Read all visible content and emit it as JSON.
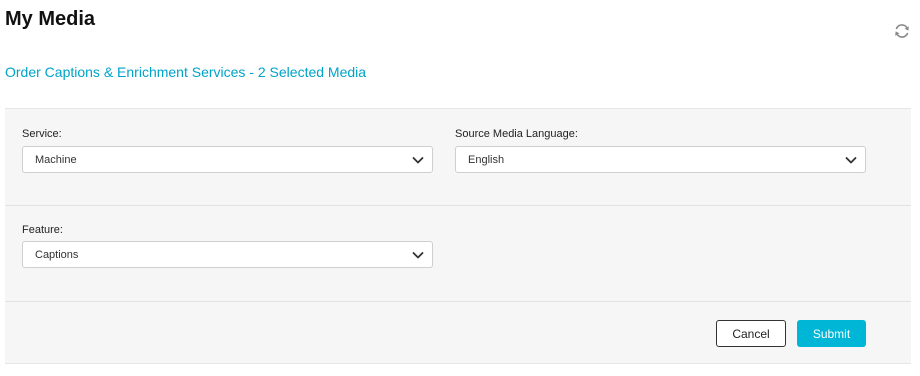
{
  "header": {
    "title": "My Media",
    "refresh_icon": "refresh-icon"
  },
  "subheader": {
    "text": "Order Captions & Enrichment Services - 2 Selected Media",
    "color": "#00a3c8"
  },
  "form": {
    "service": {
      "label": "Service:",
      "value": "Machine"
    },
    "source_language": {
      "label": "Source Media Language:",
      "value": "English"
    },
    "feature": {
      "label": "Feature:",
      "value": "Captions"
    }
  },
  "actions": {
    "cancel_label": "Cancel",
    "submit_label": "Submit",
    "submit_color": "#00b6d6"
  }
}
